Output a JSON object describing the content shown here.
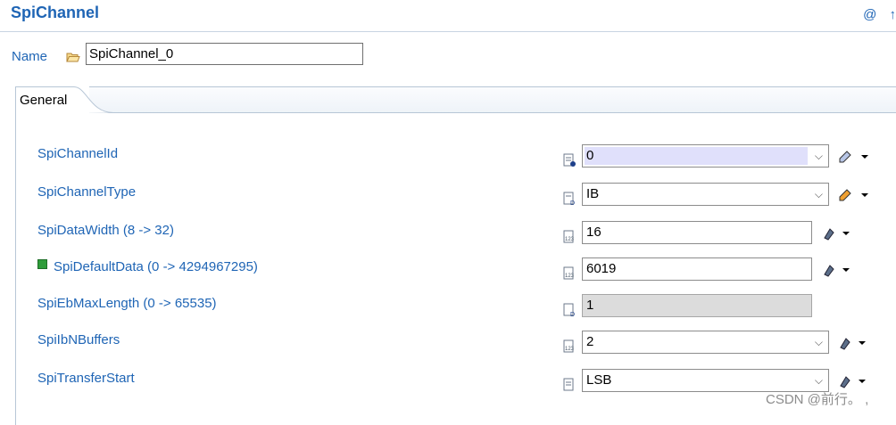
{
  "header": {
    "title": "SpiChannel",
    "icon_at": "@",
    "icon_partial": "↑"
  },
  "name_field": {
    "label": "Name",
    "value": "SpiChannel_0"
  },
  "tabs": [
    {
      "label": "General"
    }
  ],
  "rows": [
    {
      "label": "SpiChannelId",
      "value": "0",
      "type": "dropdown"
    },
    {
      "label": "SpiChannelType",
      "value": "IB",
      "type": "dropdown"
    },
    {
      "label": "SpiDataWidth (8 -> 32)",
      "value": "16",
      "type": "text"
    },
    {
      "label": "SpiDefaultData (0 -> 4294967295)",
      "value": "6019",
      "type": "text"
    },
    {
      "label": "SpiEbMaxLength (0 -> 65535)",
      "value": "1",
      "type": "disabled"
    },
    {
      "label": "SpiIbNBuffers",
      "value": "2",
      "type": "dropdown"
    },
    {
      "label": "SpiTransferStart",
      "value": "LSB",
      "type": "dropdown"
    }
  ],
  "watermark": "CSDN @前行。 ,",
  "colors": {
    "label_blue": "#1f65b5",
    "highlight": "#e0e0fb",
    "disabled_bg": "#dcdcdc"
  }
}
